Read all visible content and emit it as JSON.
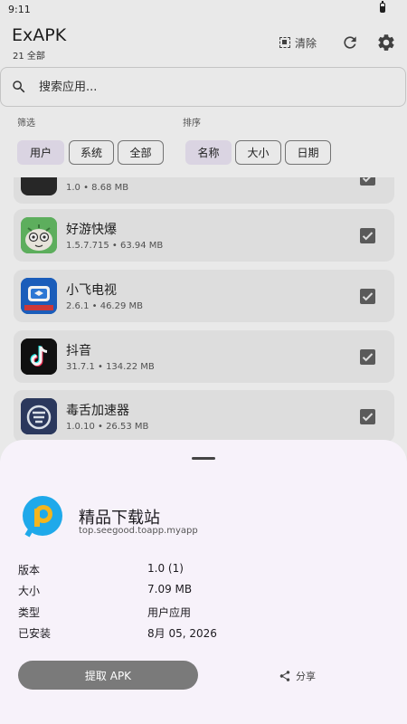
{
  "status": {
    "time": "9:11"
  },
  "header": {
    "title": "ExAPK",
    "subtitle": "21 全部",
    "clear_label": "清除"
  },
  "search": {
    "placeholder": "搜索应用..."
  },
  "filter": {
    "label": "筛选",
    "chips": [
      "用户",
      "系统",
      "全部"
    ],
    "selected": "用户"
  },
  "sort": {
    "label": "排序",
    "chips": [
      "名称",
      "大小",
      "日期"
    ],
    "selected": "名称"
  },
  "apps": [
    {
      "name": "",
      "meta": "1.0 • 8.68 MB",
      "icon": "partial-dark-app-icon",
      "checked": true
    },
    {
      "name": "好游快爆",
      "meta": "1.5.7.715 • 63.94 MB",
      "icon": "haoyou-kuaibao-icon",
      "checked": true
    },
    {
      "name": "小飞电视",
      "meta": "2.6.1 • 46.29 MB",
      "icon": "tv-app-icon",
      "checked": true
    },
    {
      "name": "抖音",
      "meta": "31.7.1 • 134.22 MB",
      "icon": "tiktok-icon",
      "checked": true
    },
    {
      "name": "毒舌加速器",
      "meta": "1.0.10 • 26.53 MB",
      "icon": "accelerator-icon",
      "checked": true
    }
  ],
  "sheet": {
    "app_name": "精品下载站",
    "package": "top.seegood.toapp.myapp",
    "details": [
      {
        "label": "版本",
        "value": "1.0 (1)"
      },
      {
        "label": "大小",
        "value": "7.09 MB"
      },
      {
        "label": "类型",
        "value": "用户应用"
      },
      {
        "label": "已安装",
        "value": "8月 05, 2026"
      }
    ],
    "extract_label": "提取 APK",
    "share_label": "分享"
  },
  "colors": {
    "accent_chip": "#e6e0ef",
    "sheet_bg": "#f7f2fa",
    "button": "#7a7a7a",
    "tiktok_bg": "#111111",
    "tv_bg": "#1d63c4"
  }
}
